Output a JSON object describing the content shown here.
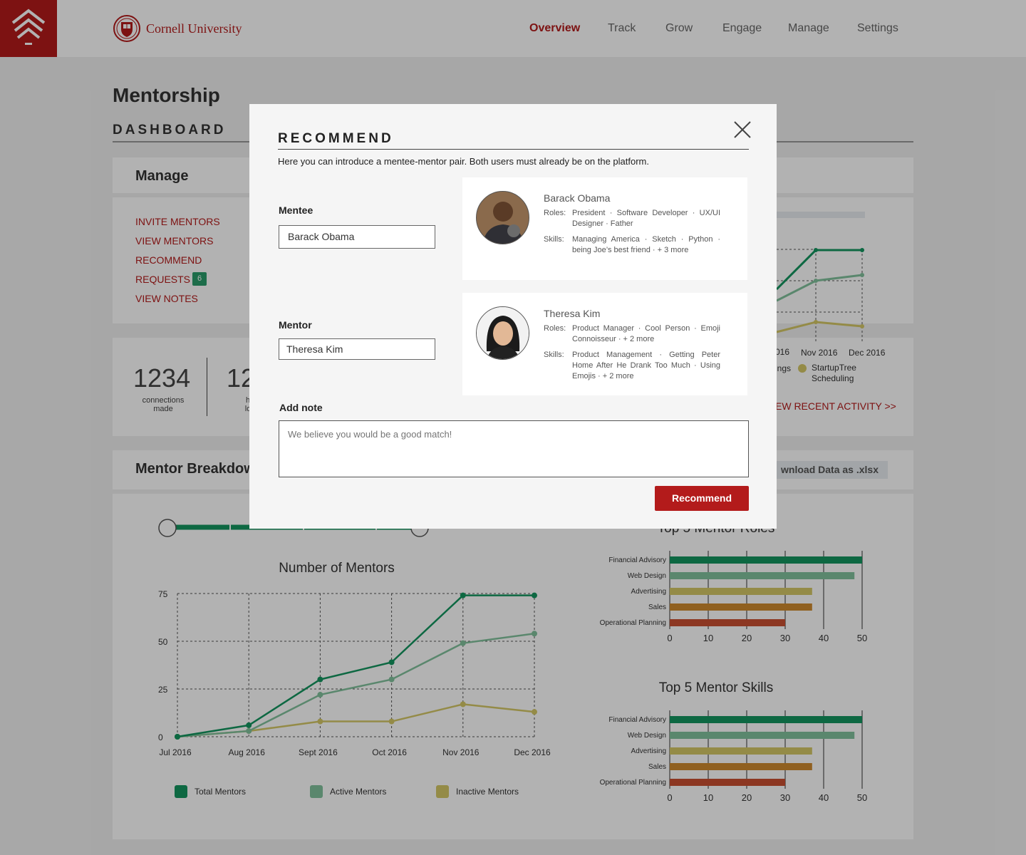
{
  "brand": {
    "name": "Cornell University"
  },
  "nav": [
    "Overview",
    "Track",
    "Grow",
    "Engage",
    "Manage",
    "Settings"
  ],
  "page": {
    "title": "Mentorship",
    "section": "DASHBOARD"
  },
  "manage": {
    "title": "Manage",
    "links": [
      "INVITE MENTORS",
      "VIEW MENTORS",
      "RECOMMEND",
      "REQUESTS",
      "VIEW NOTES"
    ],
    "requests_count": "6"
  },
  "stats": [
    {
      "value": "1234",
      "label_line1": "connections",
      "label_line2": "made"
    },
    {
      "value": "12",
      "label_line1": "h",
      "label_line2": "lo"
    }
  ],
  "activity": {
    "x_labels": [
      "016",
      "Nov 2016",
      "Dec 2016"
    ],
    "legend": [
      "ings",
      "StartupTree",
      "Scheduling"
    ],
    "view_link": "EW RECENT ACTIVITY >>"
  },
  "breakdown": {
    "title": "Mentor Breakdow",
    "download": "wnload Data as .xlsx"
  },
  "colors": {
    "accent": "#b31b1b",
    "total": "#13955f",
    "active": "#82c29c",
    "inactive": "#d4c766",
    "orange": "#cf8a2e",
    "red": "#c95032"
  },
  "chart_data": [
    {
      "type": "line",
      "title": "Number of Mentors",
      "categories": [
        "Jul 2016",
        "Aug 2016",
        "Sept 2016",
        "Oct 2016",
        "Nov 2016",
        "Dec 2016"
      ],
      "ylim": [
        0,
        75
      ],
      "yticks": [
        "0",
        "25",
        "50",
        "75"
      ],
      "grid": true,
      "series": [
        {
          "name": "Total Mentors",
          "color": "#13955f",
          "values": [
            0,
            6,
            30,
            39,
            74,
            74
          ]
        },
        {
          "name": "Active Mentors",
          "color": "#82c29c",
          "values": [
            0,
            3,
            22,
            30,
            49,
            54
          ]
        },
        {
          "name": "Inactive Mentors",
          "color": "#d4c766",
          "values": [
            0,
            3,
            8,
            8,
            17,
            13
          ]
        }
      ]
    },
    {
      "type": "bar",
      "orientation": "horizontal",
      "title": "Top 5 Mentor Roles",
      "categories": [
        "Financial Advisory",
        "Web Design",
        "Advertising",
        "Sales",
        "Operational Planning"
      ],
      "values": [
        50,
        48,
        37,
        37,
        30
      ],
      "colors": [
        "#13955f",
        "#82c29c",
        "#d4c766",
        "#cf8a2e",
        "#c95032"
      ],
      "xlim": [
        0,
        50
      ],
      "xticks": [
        "0",
        "10",
        "20",
        "30",
        "40",
        "50"
      ]
    },
    {
      "type": "bar",
      "orientation": "horizontal",
      "title": "Top 5 Mentor Skills",
      "categories": [
        "Financial Advisory",
        "Web Design",
        "Advertising",
        "Sales",
        "Operational Planning"
      ],
      "values": [
        50,
        48,
        37,
        37,
        30
      ],
      "colors": [
        "#13955f",
        "#82c29c",
        "#d4c766",
        "#cf8a2e",
        "#c95032"
      ],
      "xlim": [
        0,
        50
      ],
      "xticks": [
        "0",
        "10",
        "20",
        "30",
        "40",
        "50"
      ]
    }
  ],
  "modal": {
    "title": "RECOMMEND",
    "description": "Here you can introduce a mentee-mentor pair. Both users must already be on the platform.",
    "mentee_label": "Mentee",
    "mentee_value": "Barack Obama",
    "mentor_label": "Mentor",
    "mentor_value": "Theresa Kim",
    "note_label": "Add note",
    "note_placeholder": "We believe you would be a good match!",
    "button": "Recommend",
    "mentee_card": {
      "name": "Barack Obama",
      "roles_key": "Roles:",
      "roles": "President · Software Developer · UX/UI Designer · Father",
      "skills_key": "Skills:",
      "skills": "Managing America · Sketch · Python · being Joe’s best friend · + 3 more"
    },
    "mentor_card": {
      "name": "Theresa Kim",
      "roles_key": "Roles:",
      "roles": "Product Manager · Cool Person · Emoji Connoisseur · + 2 more",
      "skills_key": "Skills:",
      "skills": "Product Management · Getting Peter Home After He Drank Too Much · Using Emojis · + 2 more"
    }
  }
}
